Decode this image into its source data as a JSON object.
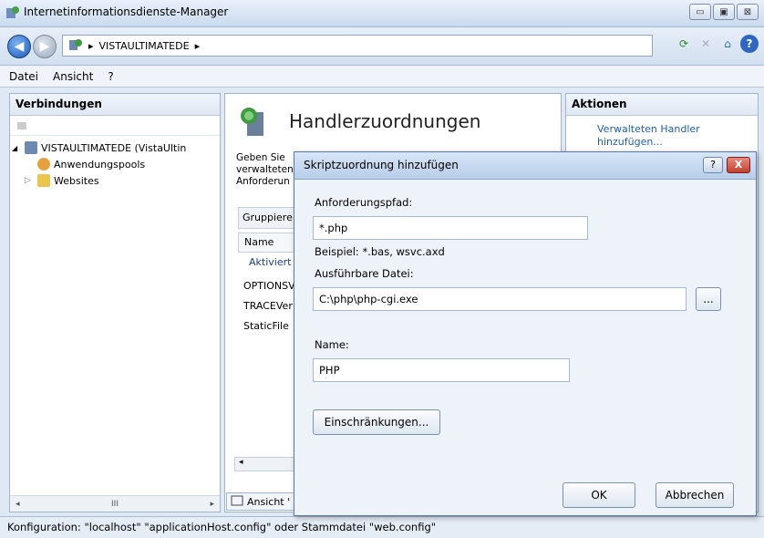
{
  "window": {
    "title": "Internetinformationsdienste-Manager",
    "min": "▭",
    "max": "▣",
    "close": "⊠"
  },
  "nav": {
    "back": "◀",
    "forward": "▶",
    "address": "VISTAULTIMATEDE",
    "sep": "▸",
    "sep2": "▸"
  },
  "toolbar": {
    "refresh": "⟳",
    "stop": "✕",
    "home": "⌂",
    "help": "?"
  },
  "menu": {
    "file": "Datei",
    "view": "Ansicht",
    "help": "?"
  },
  "connections": {
    "header": "Verbindungen",
    "tree": [
      {
        "label": "VISTAULTIMATEDE (VistaUltin",
        "expander": "◢"
      },
      {
        "label": "Anwendungspools",
        "expander": ""
      },
      {
        "label": "Websites",
        "expander": "▷"
      }
    ],
    "scroll_left": "◂",
    "scroll_mid": "III",
    "scroll_right": "▸"
  },
  "center": {
    "title": "Handlerzuordnungen",
    "desc": "Geben Sie verwalteten Anforderun",
    "group": "Gruppiere",
    "col_name": "Name",
    "group_label": "Aktiviert",
    "rows": [
      "OPTIONSV",
      "TRACEVer",
      "StaticFile"
    ],
    "scroll": "◂",
    "view_button": "Ansicht '"
  },
  "actions": {
    "header": "Aktionen",
    "item": "Verwalteten Handler hinzufügen..."
  },
  "status": {
    "text": "Konfiguration: \"localhost\" \"applicationHost.config\" oder Stammdatei \"web.config\""
  },
  "dialog": {
    "title": "Skriptzuordnung hinzufügen",
    "help": "?",
    "close": "X",
    "path_label": "Anforderungspfad:",
    "path_value": "*.php",
    "example": "Beispiel: *.bas, wsvc.axd",
    "exe_label": "Ausführbare Datei:",
    "exe_value": "C:\\php\\php-cgi.exe",
    "browse": "...",
    "name_label": "Name:",
    "name_value": "PHP",
    "restrictions": "Einschränkungen...",
    "ok": "OK",
    "cancel": "Abbrechen"
  }
}
